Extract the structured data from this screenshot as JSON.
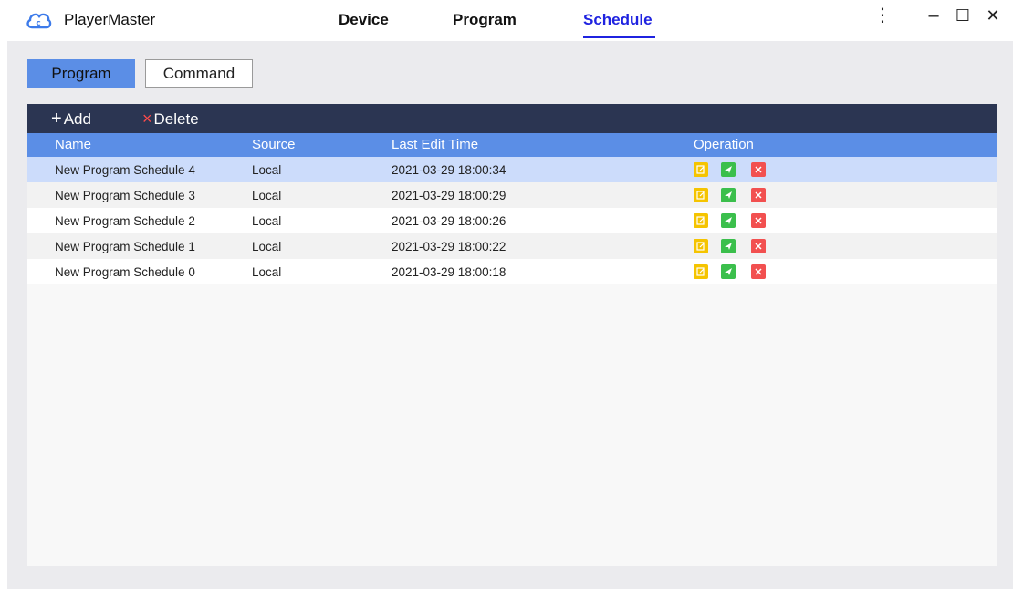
{
  "app": {
    "title": "PlayerMaster",
    "logo_icon": "cloud-icon"
  },
  "nav": {
    "tabs": [
      {
        "label": "Device",
        "active": false
      },
      {
        "label": "Program",
        "active": false
      },
      {
        "label": "Schedule",
        "active": true
      }
    ]
  },
  "window_controls": {
    "more": "⋮",
    "minimize": "–",
    "maximize": "☐",
    "close": "✕"
  },
  "segments": {
    "program": "Program",
    "command": "Command",
    "selected": "Program"
  },
  "toolbar": {
    "add_icon": "+",
    "add_label": "Add",
    "delete_icon": "×",
    "delete_label": "Delete"
  },
  "table": {
    "columns": [
      "Name",
      "Source",
      "Last Edit Time",
      "Operation"
    ],
    "rows": [
      {
        "name": "New Program Schedule 4",
        "source": "Local",
        "time": "2021-03-29 18:00:34",
        "selected": true
      },
      {
        "name": "New Program Schedule 3",
        "source": "Local",
        "time": "2021-03-29 18:00:29",
        "selected": false
      },
      {
        "name": "New Program Schedule 2",
        "source": "Local",
        "time": "2021-03-29 18:00:26",
        "selected": false
      },
      {
        "name": "New Program Schedule 1",
        "source": "Local",
        "time": "2021-03-29 18:00:22",
        "selected": false
      },
      {
        "name": "New Program Schedule 0",
        "source": "Local",
        "time": "2021-03-29 18:00:18",
        "selected": false
      }
    ],
    "operations": [
      "edit-icon",
      "send-icon",
      "delete-icon"
    ]
  },
  "colors": {
    "accent": "#1f23e0",
    "header_blue": "#5b8ee6",
    "toolbar_dark": "#2b3552",
    "selected_row": "#ccdcfb",
    "edit": "#f5c400",
    "send": "#3bbf4c",
    "delete": "#f25050"
  }
}
